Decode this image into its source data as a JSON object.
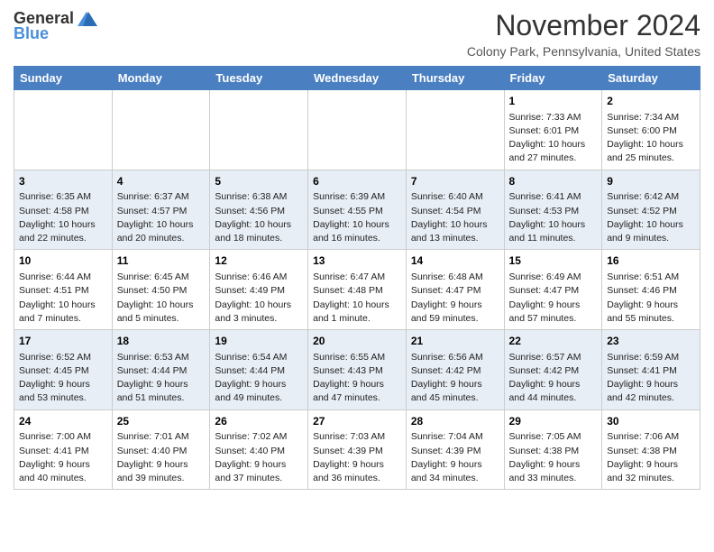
{
  "header": {
    "logo_general": "General",
    "logo_blue": "Blue",
    "month_title": "November 2024",
    "location": "Colony Park, Pennsylvania, United States"
  },
  "weekdays": [
    "Sunday",
    "Monday",
    "Tuesday",
    "Wednesday",
    "Thursday",
    "Friday",
    "Saturday"
  ],
  "weeks": [
    [
      {
        "day": "",
        "info": ""
      },
      {
        "day": "",
        "info": ""
      },
      {
        "day": "",
        "info": ""
      },
      {
        "day": "",
        "info": ""
      },
      {
        "day": "",
        "info": ""
      },
      {
        "day": "1",
        "info": "Sunrise: 7:33 AM\nSunset: 6:01 PM\nDaylight: 10 hours and 27 minutes."
      },
      {
        "day": "2",
        "info": "Sunrise: 7:34 AM\nSunset: 6:00 PM\nDaylight: 10 hours and 25 minutes."
      }
    ],
    [
      {
        "day": "3",
        "info": "Sunrise: 6:35 AM\nSunset: 4:58 PM\nDaylight: 10 hours and 22 minutes."
      },
      {
        "day": "4",
        "info": "Sunrise: 6:37 AM\nSunset: 4:57 PM\nDaylight: 10 hours and 20 minutes."
      },
      {
        "day": "5",
        "info": "Sunrise: 6:38 AM\nSunset: 4:56 PM\nDaylight: 10 hours and 18 minutes."
      },
      {
        "day": "6",
        "info": "Sunrise: 6:39 AM\nSunset: 4:55 PM\nDaylight: 10 hours and 16 minutes."
      },
      {
        "day": "7",
        "info": "Sunrise: 6:40 AM\nSunset: 4:54 PM\nDaylight: 10 hours and 13 minutes."
      },
      {
        "day": "8",
        "info": "Sunrise: 6:41 AM\nSunset: 4:53 PM\nDaylight: 10 hours and 11 minutes."
      },
      {
        "day": "9",
        "info": "Sunrise: 6:42 AM\nSunset: 4:52 PM\nDaylight: 10 hours and 9 minutes."
      }
    ],
    [
      {
        "day": "10",
        "info": "Sunrise: 6:44 AM\nSunset: 4:51 PM\nDaylight: 10 hours and 7 minutes."
      },
      {
        "day": "11",
        "info": "Sunrise: 6:45 AM\nSunset: 4:50 PM\nDaylight: 10 hours and 5 minutes."
      },
      {
        "day": "12",
        "info": "Sunrise: 6:46 AM\nSunset: 4:49 PM\nDaylight: 10 hours and 3 minutes."
      },
      {
        "day": "13",
        "info": "Sunrise: 6:47 AM\nSunset: 4:48 PM\nDaylight: 10 hours and 1 minute."
      },
      {
        "day": "14",
        "info": "Sunrise: 6:48 AM\nSunset: 4:47 PM\nDaylight: 9 hours and 59 minutes."
      },
      {
        "day": "15",
        "info": "Sunrise: 6:49 AM\nSunset: 4:47 PM\nDaylight: 9 hours and 57 minutes."
      },
      {
        "day": "16",
        "info": "Sunrise: 6:51 AM\nSunset: 4:46 PM\nDaylight: 9 hours and 55 minutes."
      }
    ],
    [
      {
        "day": "17",
        "info": "Sunrise: 6:52 AM\nSunset: 4:45 PM\nDaylight: 9 hours and 53 minutes."
      },
      {
        "day": "18",
        "info": "Sunrise: 6:53 AM\nSunset: 4:44 PM\nDaylight: 9 hours and 51 minutes."
      },
      {
        "day": "19",
        "info": "Sunrise: 6:54 AM\nSunset: 4:44 PM\nDaylight: 9 hours and 49 minutes."
      },
      {
        "day": "20",
        "info": "Sunrise: 6:55 AM\nSunset: 4:43 PM\nDaylight: 9 hours and 47 minutes."
      },
      {
        "day": "21",
        "info": "Sunrise: 6:56 AM\nSunset: 4:42 PM\nDaylight: 9 hours and 45 minutes."
      },
      {
        "day": "22",
        "info": "Sunrise: 6:57 AM\nSunset: 4:42 PM\nDaylight: 9 hours and 44 minutes."
      },
      {
        "day": "23",
        "info": "Sunrise: 6:59 AM\nSunset: 4:41 PM\nDaylight: 9 hours and 42 minutes."
      }
    ],
    [
      {
        "day": "24",
        "info": "Sunrise: 7:00 AM\nSunset: 4:41 PM\nDaylight: 9 hours and 40 minutes."
      },
      {
        "day": "25",
        "info": "Sunrise: 7:01 AM\nSunset: 4:40 PM\nDaylight: 9 hours and 39 minutes."
      },
      {
        "day": "26",
        "info": "Sunrise: 7:02 AM\nSunset: 4:40 PM\nDaylight: 9 hours and 37 minutes."
      },
      {
        "day": "27",
        "info": "Sunrise: 7:03 AM\nSunset: 4:39 PM\nDaylight: 9 hours and 36 minutes."
      },
      {
        "day": "28",
        "info": "Sunrise: 7:04 AM\nSunset: 4:39 PM\nDaylight: 9 hours and 34 minutes."
      },
      {
        "day": "29",
        "info": "Sunrise: 7:05 AM\nSunset: 4:38 PM\nDaylight: 9 hours and 33 minutes."
      },
      {
        "day": "30",
        "info": "Sunrise: 7:06 AM\nSunset: 4:38 PM\nDaylight: 9 hours and 32 minutes."
      }
    ]
  ]
}
